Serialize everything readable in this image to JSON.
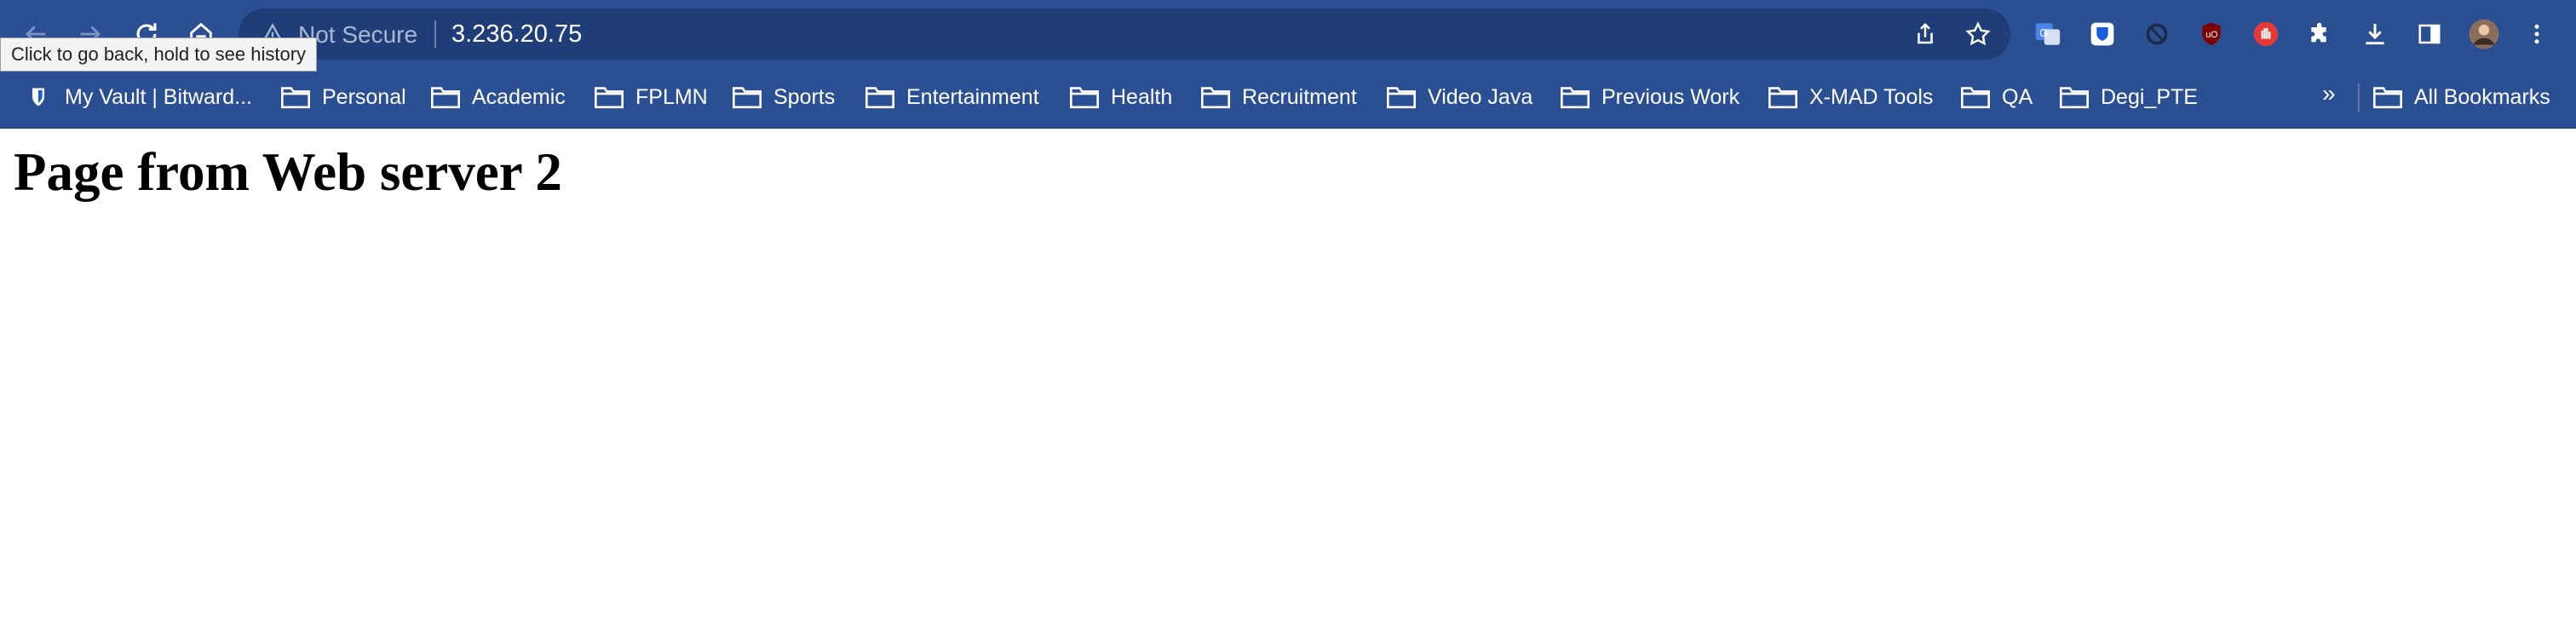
{
  "tooltip": "Click to go back, hold to see history",
  "omnibox": {
    "security_label": "Not Secure",
    "url": "3.236.20.75"
  },
  "bookmarks": [
    {
      "label": "My Vault | Bitward...",
      "icon": "bitwarden-icon"
    },
    {
      "label": "Personal",
      "icon": "folder-icon"
    },
    {
      "label": "Academic",
      "icon": "folder-icon"
    },
    {
      "label": "FPLMN",
      "icon": "folder-icon"
    },
    {
      "label": "Sports",
      "icon": "folder-icon"
    },
    {
      "label": "Entertainment",
      "icon": "folder-icon"
    },
    {
      "label": "Health",
      "icon": "folder-icon"
    },
    {
      "label": "Recruitment",
      "icon": "folder-icon"
    },
    {
      "label": "Video Java",
      "icon": "folder-icon"
    },
    {
      "label": "Previous Work",
      "icon": "folder-icon"
    },
    {
      "label": "X-MAD Tools",
      "icon": "folder-icon"
    },
    {
      "label": "QA",
      "icon": "folder-icon"
    },
    {
      "label": "Degi_PTE",
      "icon": "folder-icon"
    }
  ],
  "bookmarks_overflow": "»",
  "all_bookmarks_label": "All Bookmarks",
  "page": {
    "heading": "Page from Web server 2"
  },
  "colors": {
    "toolbar_bg": "#2b4f93",
    "omnibox_bg": "#1f3e78",
    "page_bg": "#ffffff"
  }
}
